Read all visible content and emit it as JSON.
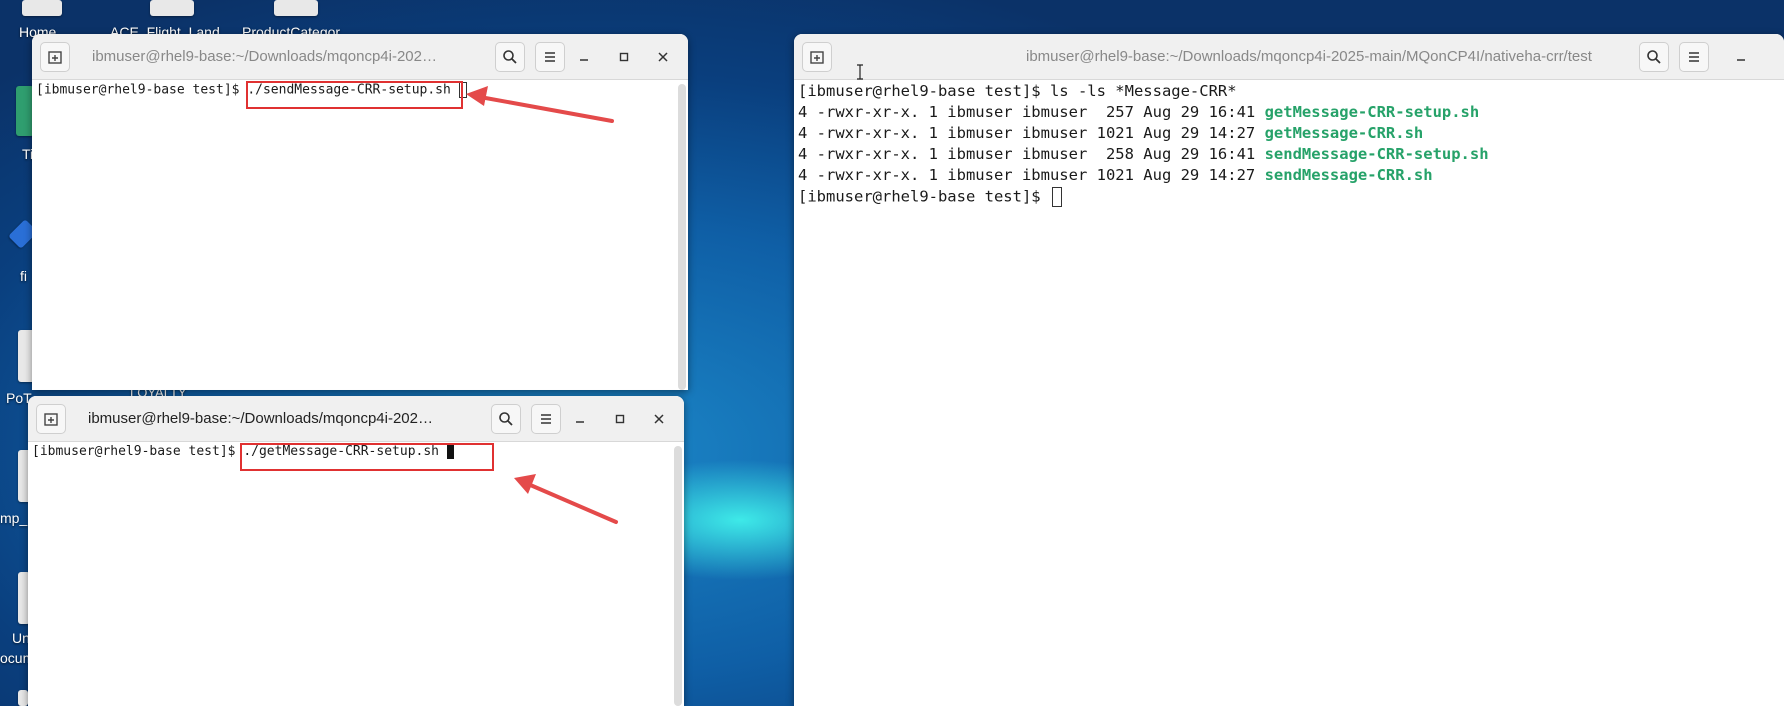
{
  "desktop": {
    "icons": [
      "Home",
      "ACE_Flight_Land",
      "ProductCategor",
      "Ti",
      "fi",
      "PoT",
      "LOYALTY",
      "mp_",
      "Un",
      "ocum"
    ]
  },
  "window_left_top": {
    "title": "ibmuser@rhel9-base:~/Downloads/mqoncp4i-202…",
    "prompt": "[ibmuser@rhel9-base test]$ ",
    "command": "./sendMessage-CRR-setup.sh"
  },
  "window_left_bottom": {
    "title": "ibmuser@rhel9-base:~/Downloads/mqoncp4i-202…",
    "prompt": "[ibmuser@rhel9-base test]$ ",
    "command": "./getMessage-CRR-setup.sh"
  },
  "window_right": {
    "title": "ibmuser@rhel9-base:~/Downloads/mqoncp4i-2025-main/MQonCP4I/nativeha-crr/test",
    "cmd_line": "[ibmuser@rhel9-base test]$ ls -ls *Message-CRR*",
    "listing": [
      {
        "prefix": "4 -rwxr-xr-x. 1 ibmuser ibmuser  257 Aug 29 16:41 ",
        "file": "getMessage-CRR-setup.sh"
      },
      {
        "prefix": "4 -rwxr-xr-x. 1 ibmuser ibmuser 1021 Aug 29 14:27 ",
        "file": "getMessage-CRR.sh"
      },
      {
        "prefix": "4 -rwxr-xr-x. 1 ibmuser ibmuser  258 Aug 29 16:41 ",
        "file": "sendMessage-CRR-setup.sh"
      },
      {
        "prefix": "4 -rwxr-xr-x. 1 ibmuser ibmuser 1021 Aug 29 14:27 ",
        "file": "sendMessage-CRR.sh"
      }
    ],
    "final_prompt": "[ibmuser@rhel9-base test]$ "
  },
  "colors": {
    "highlight": "#e03131",
    "filename_green": "#26a269",
    "desktop_blue": "#0f5fa6"
  },
  "icons": [
    "new-tab-icon",
    "search-icon",
    "menu-icon",
    "minimize-icon",
    "maximize-icon",
    "close-icon",
    "text-cursor-icon"
  ]
}
